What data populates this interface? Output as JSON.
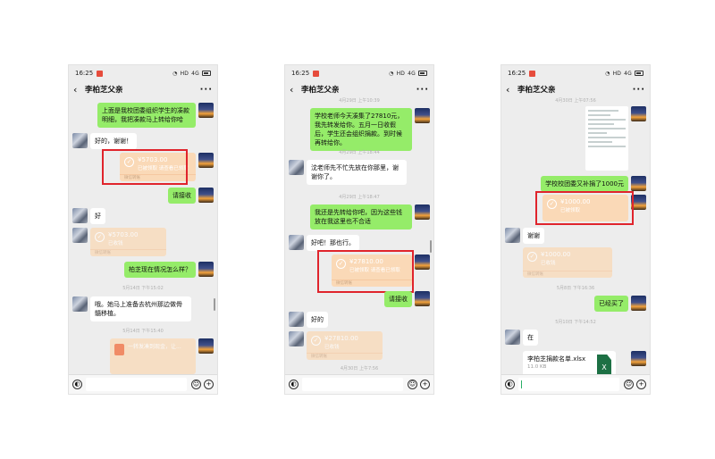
{
  "status": {
    "time": "16:25",
    "network": "HD",
    "signal": "4G"
  },
  "chat": {
    "title": "李柏芝父亲"
  },
  "phone1": {
    "m1": "上面是我校团委组织学生的凑款明细，我把凑款马上转给你哈",
    "m2": "好的，谢谢！",
    "t1_amount": "¥5703.00",
    "t1_sub": "已被领取 请查看已领取",
    "m3": "请接收",
    "m4": "好",
    "t2_amount": "¥5703.00",
    "t2_sub": "已收钱",
    "m5": "柏芝现在情况怎么样？",
    "ts1": "5月14日 下午15:02",
    "m6": "哦。她马上准备去杭州那边做骨髓移植。",
    "ts2": "5月14日 下午15:40",
    "rp": "一转发凑到现金，让..."
  },
  "phone2": {
    "ts0": "4月29日 上午10:39",
    "m1": "学校老师今天凑集了27810元，我先转发给你。五月一日收假后，学生还会组织捐款。到时候再转给你。",
    "ts1": "4月29日 上午18:44",
    "m2": "沈老师先不忙先放在你那里，谢谢你了。",
    "ts2": "4月29日 上午18:47",
    "m3": "我还是先转给你吧，因为这些钱放在我这里也不合适",
    "m4": "好吧！那也行。",
    "t1_amount": "¥27810.00",
    "t1_sub": "已被领取 请查看已领取",
    "m5": "请接收",
    "m6": "好的",
    "t2_amount": "¥27810.00",
    "t2_sub": "已收钱",
    "ts3": "4月30日 上午7:56"
  },
  "phone3": {
    "ts0": "4月30日 上午07:56",
    "m1": "学校校团委又补捐了1000元",
    "t1_amount": "¥1000.00",
    "t1_sub": "已被领取",
    "m2": "谢谢",
    "t2_amount": "¥1000.00",
    "t2_sub": "已收钱",
    "ts1": "5月8日 下午16:36",
    "m3": "已经买了",
    "ts2": "5月10日 下午14:52",
    "m4": "在",
    "file_name": "李柏芝捐款名单.xlsx",
    "file_size": "11.0 KB"
  },
  "transfer_footer": "微信转账",
  "colors": {
    "green_bubble": "#95ec69",
    "transfer": "#fad9b7",
    "highlight": "#e0242c",
    "background": "#ededed"
  }
}
